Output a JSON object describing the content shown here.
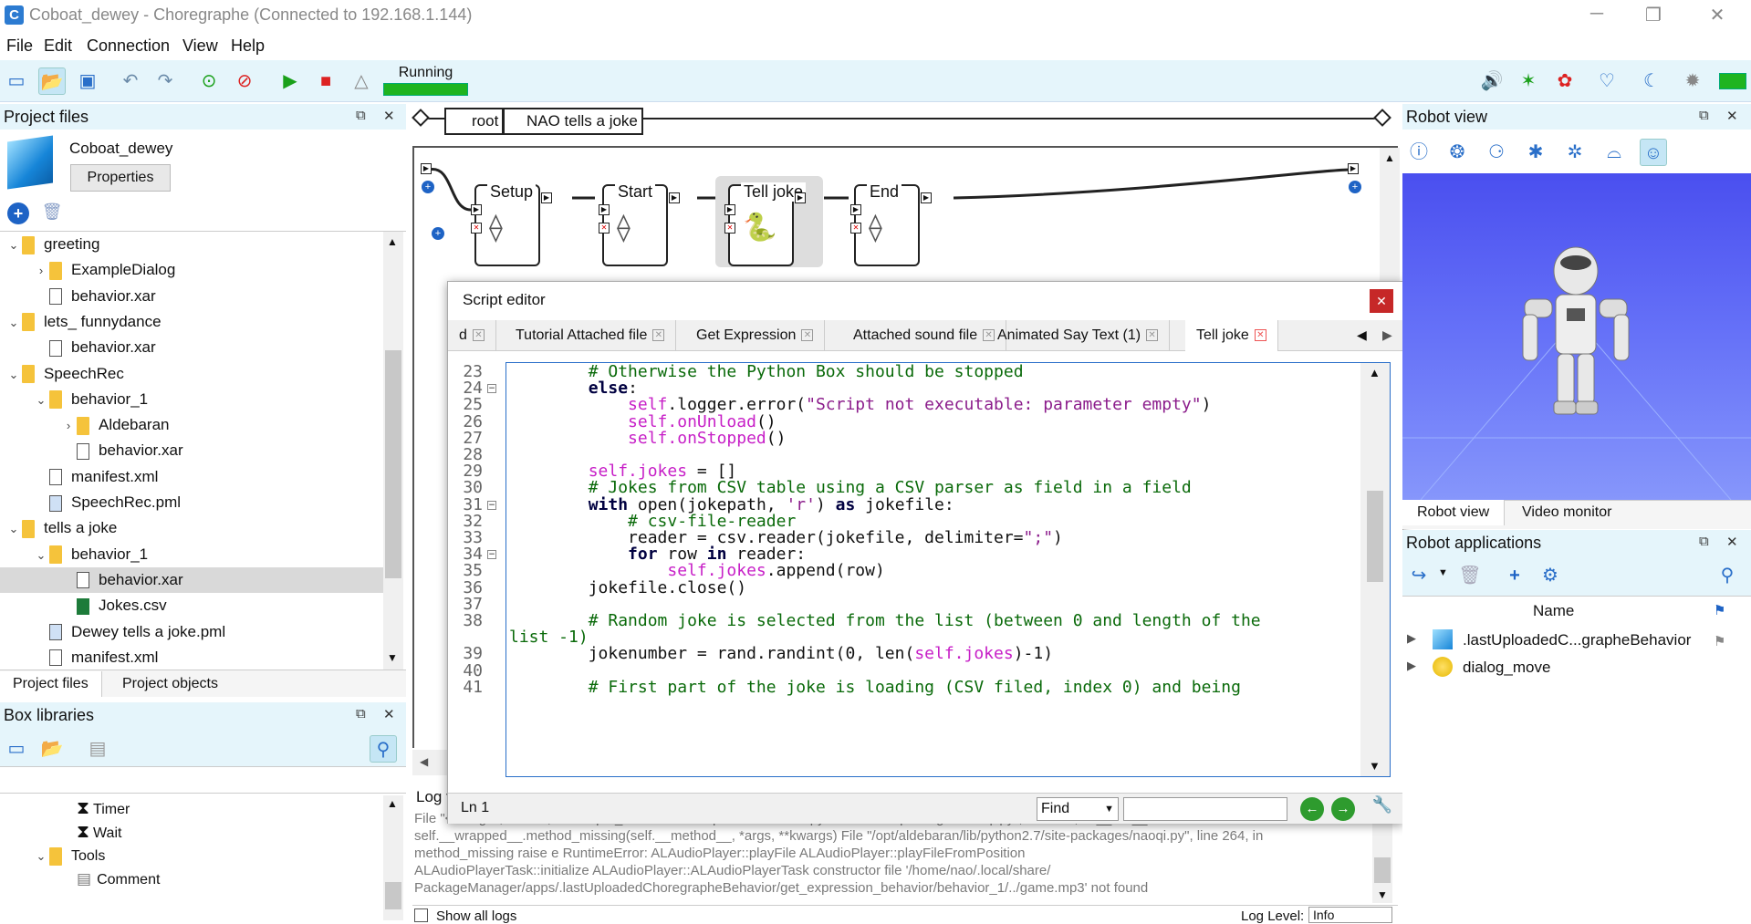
{
  "window": {
    "title": "Coboat_dewey - Choregraphe (Connected to 192.168.1.144)",
    "app_icon": "C"
  },
  "menu": [
    "File",
    "Edit",
    "Connection",
    "View",
    "Help"
  ],
  "status": {
    "label": "Running",
    "color": "#1fb41f"
  },
  "project_files": {
    "header": "Project files",
    "project_name": "Coboat_dewey",
    "properties_label": "Properties",
    "tree": [
      {
        "label": "greeting",
        "type": "folder",
        "depth": 0,
        "arrow": "down"
      },
      {
        "label": "ExampleDialog",
        "type": "folder",
        "depth": 1,
        "arrow": "right"
      },
      {
        "label": "behavior.xar",
        "type": "file",
        "depth": 1
      },
      {
        "label": "lets_ funnydance",
        "type": "folder",
        "depth": 0,
        "arrow": "down"
      },
      {
        "label": "behavior.xar",
        "type": "file",
        "depth": 1
      },
      {
        "label": "SpeechRec",
        "type": "folder",
        "depth": 0,
        "arrow": "down"
      },
      {
        "label": "behavior_1",
        "type": "folder",
        "depth": 1,
        "arrow": "down"
      },
      {
        "label": "Aldebaran",
        "type": "folder",
        "depth": 2,
        "arrow": "right"
      },
      {
        "label": "behavior.xar",
        "type": "file",
        "depth": 2
      },
      {
        "label": "manifest.xml",
        "type": "file",
        "depth": 1
      },
      {
        "label": "SpeechRec.pml",
        "type": "pml",
        "depth": 1
      },
      {
        "label": "tells a joke",
        "type": "folder",
        "depth": 0,
        "arrow": "down"
      },
      {
        "label": "behavior_1",
        "type": "folder",
        "depth": 1,
        "arrow": "down"
      },
      {
        "label": "behavior.xar",
        "type": "file",
        "depth": 2,
        "selected": true
      },
      {
        "label": "Jokes.csv",
        "type": "csv",
        "depth": 2
      },
      {
        "label": "Dewey tells a joke.pml",
        "type": "pml",
        "depth": 1
      },
      {
        "label": "manifest.xml",
        "type": "file",
        "depth": 1
      }
    ],
    "tabs": [
      "Project files",
      "Project objects"
    ]
  },
  "box_libraries": {
    "header": "Box libraries",
    "items": [
      {
        "label": "Timer",
        "type": "hourglass",
        "depth": 2
      },
      {
        "label": "Wait",
        "type": "hourglass",
        "depth": 2
      },
      {
        "label": "Tools",
        "type": "folder",
        "depth": 1,
        "arrow": "down"
      },
      {
        "label": "Comment",
        "type": "comment",
        "depth": 2
      }
    ]
  },
  "breadcrumb": [
    "root",
    "NAO tells a joke"
  ],
  "flow_boxes": [
    "Setup",
    "Start",
    "Tell joke",
    "End"
  ],
  "script_editor": {
    "title": "Script editor",
    "tabs": [
      "d",
      "Tutorial Attached file",
      "Get Expression",
      "Attached sound file",
      "Animated Say Text (1)",
      "Tell joke"
    ],
    "active_tab": "Tell joke",
    "status_line": "Ln 1",
    "find_label": "Find",
    "find_value": ""
  },
  "code_lines": [
    {
      "n": "23",
      "segs": [
        [
          "        ",
          ""
        ],
        [
          "# Otherwise the Python Box should be stopped",
          "cm"
        ]
      ]
    },
    {
      "n": "24",
      "fold": true,
      "segs": [
        [
          "        ",
          ""
        ],
        [
          "else",
          "kw"
        ],
        [
          ":",
          ""
        ]
      ]
    },
    {
      "n": "25",
      "segs": [
        [
          "            ",
          ""
        ],
        [
          "self",
          "slf"
        ],
        [
          ".logger",
          ""
        ],
        [
          ".error(",
          ""
        ],
        [
          "\"Script not executable: parameter empty\"",
          "str"
        ],
        [
          ")",
          ""
        ]
      ]
    },
    {
      "n": "26",
      "segs": [
        [
          "            ",
          ""
        ],
        [
          "self.onUnload",
          "slf"
        ],
        [
          "()",
          ""
        ]
      ]
    },
    {
      "n": "27",
      "segs": [
        [
          "            ",
          ""
        ],
        [
          "self.onStopped",
          "slf"
        ],
        [
          "()",
          ""
        ]
      ]
    },
    {
      "n": "28",
      "segs": []
    },
    {
      "n": "29",
      "segs": [
        [
          "        ",
          ""
        ],
        [
          "self.jokes",
          "slf"
        ],
        [
          " = []",
          ""
        ]
      ]
    },
    {
      "n": "30",
      "segs": [
        [
          "        ",
          ""
        ],
        [
          "# Jokes from CSV table using a CSV parser as field in a field",
          "cm"
        ]
      ]
    },
    {
      "n": "31",
      "fold": true,
      "segs": [
        [
          "        ",
          ""
        ],
        [
          "with",
          "kw"
        ],
        [
          " open(jokepath, ",
          ""
        ],
        [
          "'r'",
          "str"
        ],
        [
          ") ",
          ""
        ],
        [
          "as",
          "kw"
        ],
        [
          " jokefile:",
          ""
        ]
      ]
    },
    {
      "n": "32",
      "segs": [
        [
          "            ",
          ""
        ],
        [
          "# csv-file-reader",
          "cm"
        ]
      ]
    },
    {
      "n": "33",
      "segs": [
        [
          "            ",
          ""
        ],
        [
          "reader = csv.reader(jokefile, delimiter=",
          ""
        ],
        [
          "\";\"",
          "str"
        ],
        [
          ")",
          ""
        ]
      ]
    },
    {
      "n": "34",
      "fold": true,
      "segs": [
        [
          "            ",
          ""
        ],
        [
          "for",
          "kw"
        ],
        [
          " row ",
          ""
        ],
        [
          "in",
          "kw"
        ],
        [
          " reader:",
          ""
        ]
      ]
    },
    {
      "n": "35",
      "segs": [
        [
          "                ",
          ""
        ],
        [
          "self.jokes",
          "slf"
        ],
        [
          ".append(row)",
          ""
        ]
      ]
    },
    {
      "n": "36",
      "segs": [
        [
          "        ",
          ""
        ],
        [
          "jokefile.close()",
          ""
        ]
      ]
    },
    {
      "n": "37",
      "segs": []
    },
    {
      "n": "38",
      "segs": [
        [
          "        ",
          ""
        ],
        [
          "# Random joke is selected from the list (between 0 and length of the",
          "cm"
        ]
      ]
    },
    {
      "n": "",
      "segs": [
        [
          "list -1)",
          "cm"
        ]
      ]
    },
    {
      "n": "39",
      "segs": [
        [
          "        ",
          ""
        ],
        [
          "jokenumber = rand.randint(0, len(",
          ""
        ],
        [
          "self.jokes",
          "slf"
        ],
        [
          ")-1)",
          ""
        ]
      ]
    },
    {
      "n": "40",
      "segs": []
    },
    {
      "n": "41",
      "segs": [
        [
          "        ",
          ""
        ],
        [
          "# First part of the joke is loading (CSV filed, index 0) and being",
          "cm"
        ]
      ]
    }
  ],
  "log": {
    "header": "Log v",
    "lines": [
      "File \"<string>\", line 31, in onInput_onStart    File \"/opt/aldebaran/lib/python2.7/site-packages/naoqi.py\", line 194, in __call__    return",
      "self.__wrapped__.method_missing(self.__method__, *args, **kwargs)   File \"/opt/aldebaran/lib/python2.7/site-packages/naoqi.py\", line 264, in",
      "method_missing     raise e RuntimeError:         ALAudioPlayer::playFile                          ALAudioPlayer::playFileFromPosition",
      "ALAudioPlayerTask::initialize           ALAudioPlayer::ALAudioPlayerTask constructor            file '/home/nao/.local/share/",
      "PackageManager/apps/.lastUploadedChoregrapheBehavior/get_expression_behavior/behavior_1/../game.mp3' not found"
    ],
    "show_all_label": "Show all logs",
    "log_level_label": "Log Level:",
    "log_level_value": "Info"
  },
  "robot_view": {
    "header": "Robot view",
    "tabs": [
      "Robot view",
      "Video monitor"
    ]
  },
  "robot_apps": {
    "header": "Robot applications",
    "column": "Name",
    "items": [
      ".lastUploadedC...grapheBehavior",
      "dialog_move"
    ]
  }
}
